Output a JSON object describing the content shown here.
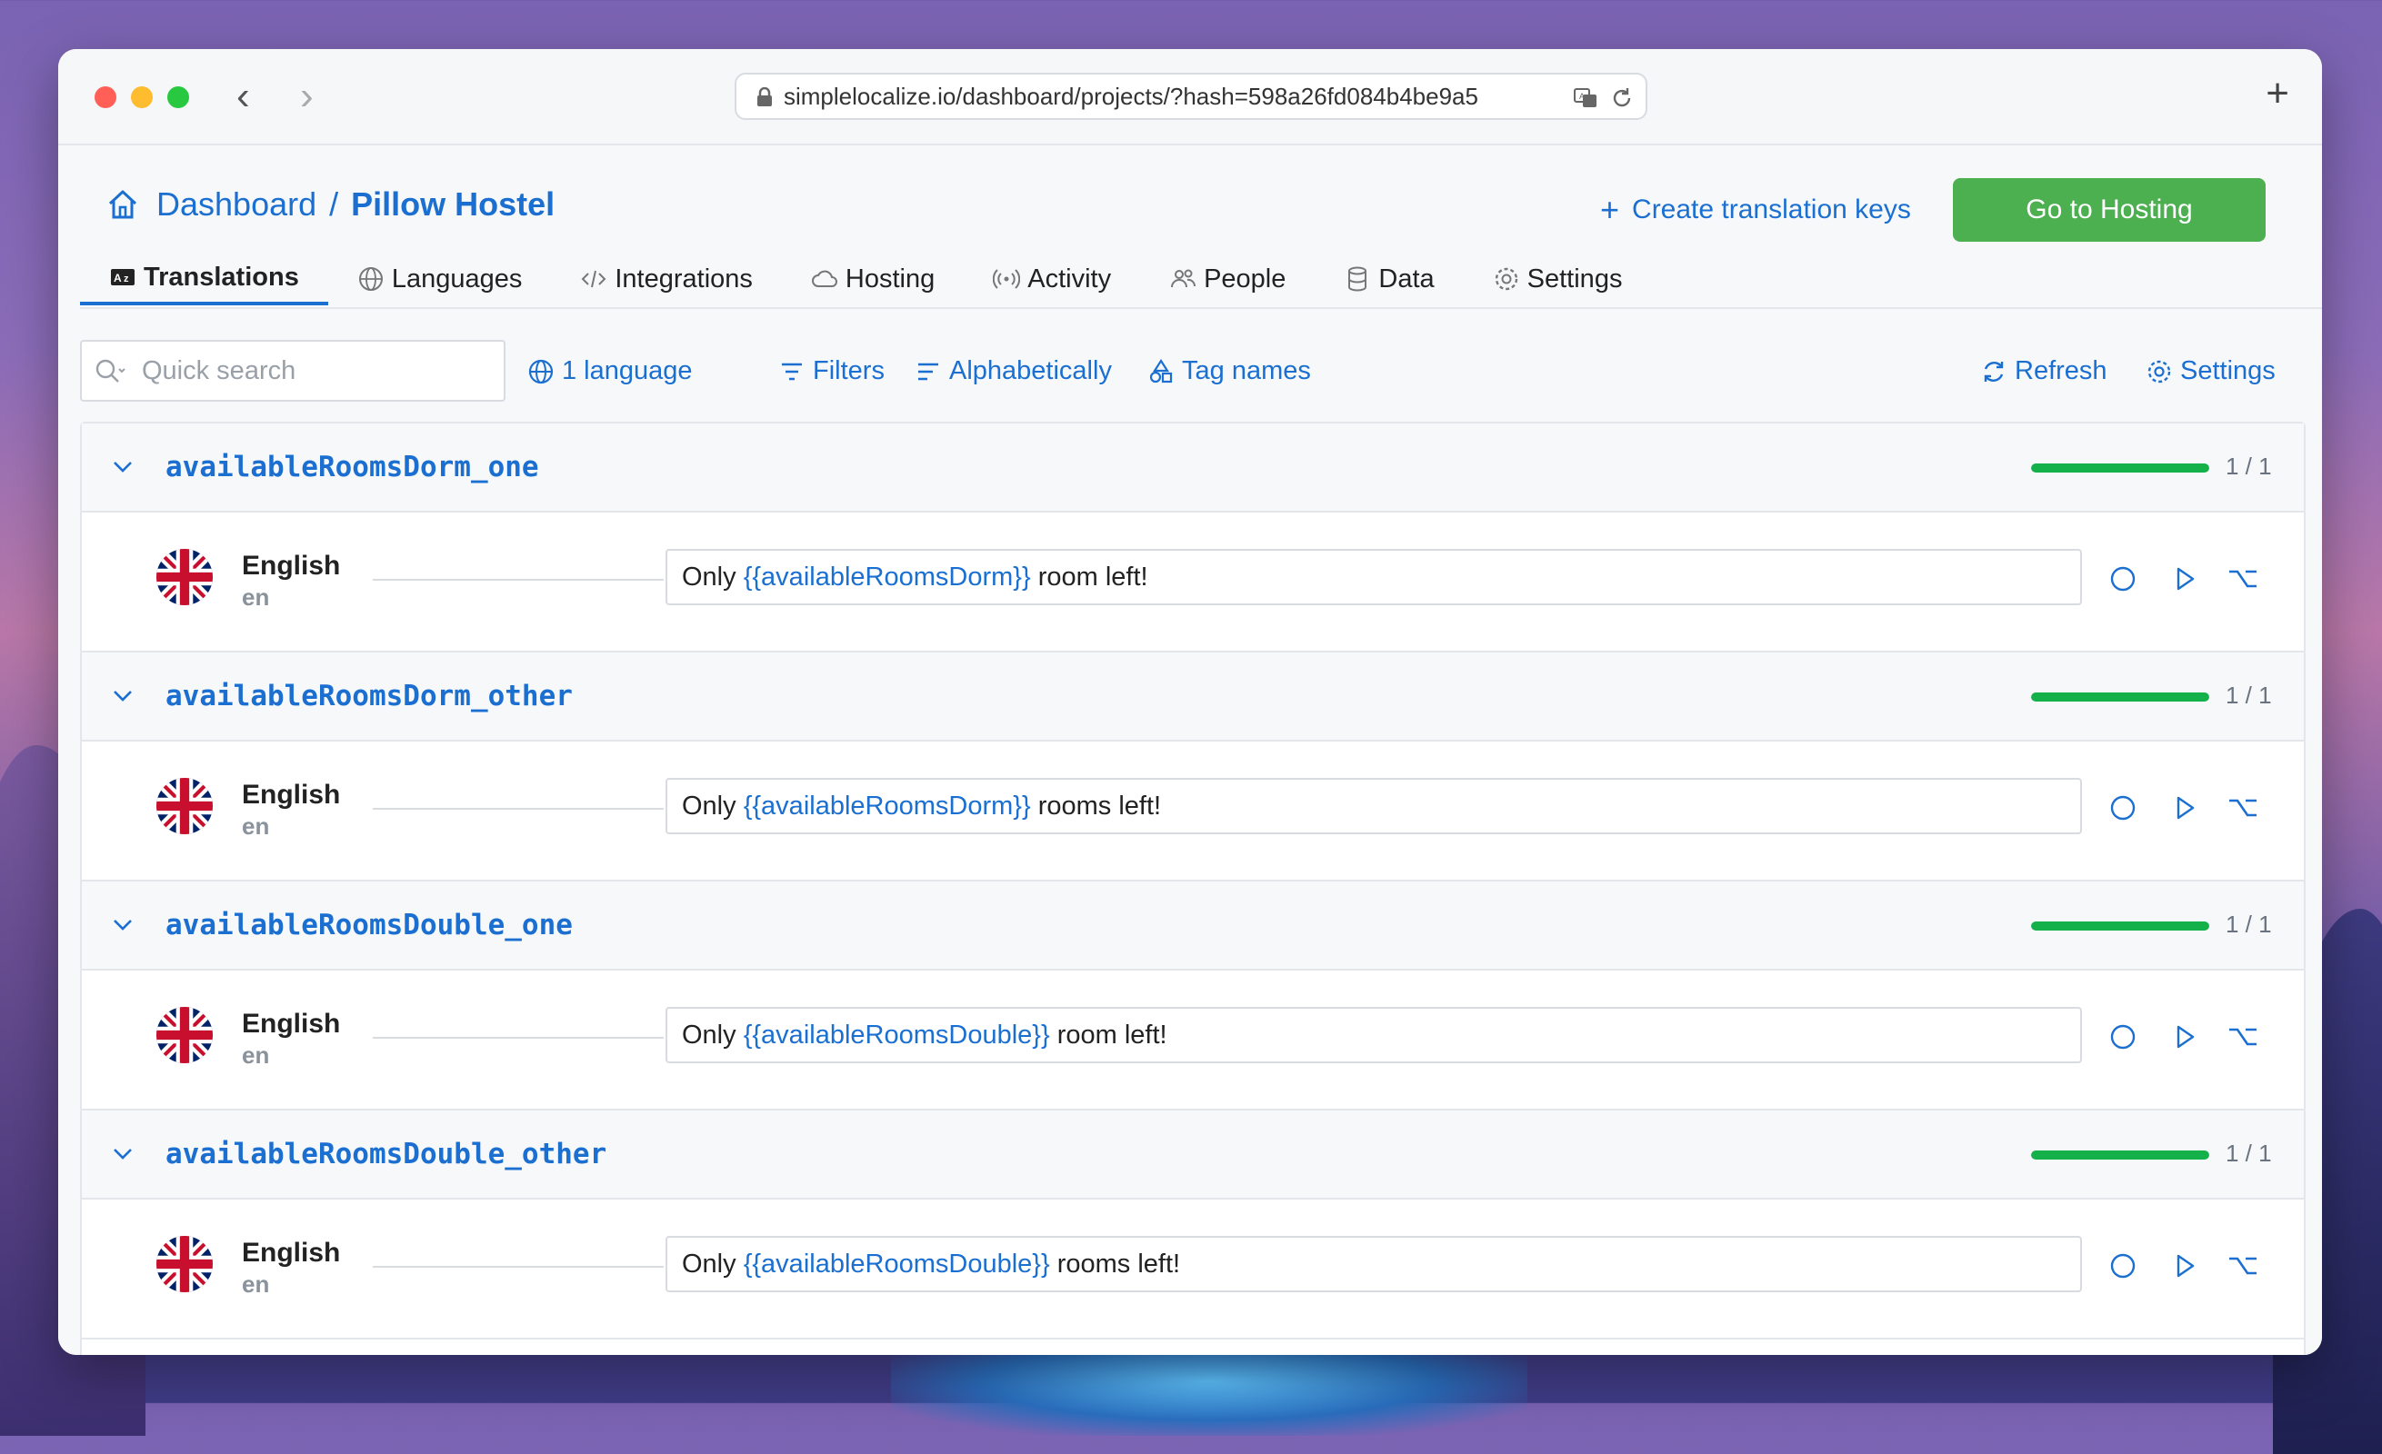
{
  "browser": {
    "url": "simplelocalize.io/dashboard/projects/?hash=598a26fd084b4be9a5",
    "new_tab": "+"
  },
  "breadcrumb": {
    "dashboard": "Dashboard",
    "separator": "/",
    "project": "Pillow Hostel"
  },
  "header": {
    "create_keys": "Create translation keys",
    "go_hosting": "Go to Hosting"
  },
  "tabs": [
    {
      "label": "Translations",
      "icon": "translate-icon",
      "active": true
    },
    {
      "label": "Languages",
      "icon": "globe-icon"
    },
    {
      "label": "Integrations",
      "icon": "code-icon"
    },
    {
      "label": "Hosting",
      "icon": "cloud-icon"
    },
    {
      "label": "Activity",
      "icon": "broadcast-icon"
    },
    {
      "label": "People",
      "icon": "people-icon"
    },
    {
      "label": "Data",
      "icon": "database-icon"
    },
    {
      "label": "Settings",
      "icon": "gear-icon"
    }
  ],
  "toolbar": {
    "search_placeholder": "Quick search",
    "languages": "1 language",
    "filters": "Filters",
    "sort": "Alphabetically",
    "tags": "Tag names",
    "refresh": "Refresh",
    "settings": "Settings",
    "more": "···"
  },
  "colors": {
    "accent": "#1a6fd1",
    "success": "#4caf50",
    "progress": "#14b04a"
  },
  "groups": [
    {
      "key": "availableRoomsDorm_one",
      "progress": 1,
      "ratio": "1 / 1",
      "lang": "English",
      "code": "en",
      "pre": "Only ",
      "ph": "{{availableRoomsDorm}}",
      "post": " room left!"
    },
    {
      "key": "availableRoomsDorm_other",
      "progress": 1,
      "ratio": "1 / 1",
      "lang": "English",
      "code": "en",
      "pre": "Only ",
      "ph": "{{availableRoomsDorm}}",
      "post": " rooms left!"
    },
    {
      "key": "availableRoomsDouble_one",
      "progress": 1,
      "ratio": "1 / 1",
      "lang": "English",
      "code": "en",
      "pre": "Only ",
      "ph": "{{availableRoomsDouble}}",
      "post": " room left!"
    },
    {
      "key": "availableRoomsDouble_other",
      "progress": 1,
      "ratio": "1 / 1",
      "lang": "English",
      "code": "en",
      "pre": "Only ",
      "ph": "{{availableRoomsDouble}}",
      "post": " rooms left!"
    }
  ]
}
